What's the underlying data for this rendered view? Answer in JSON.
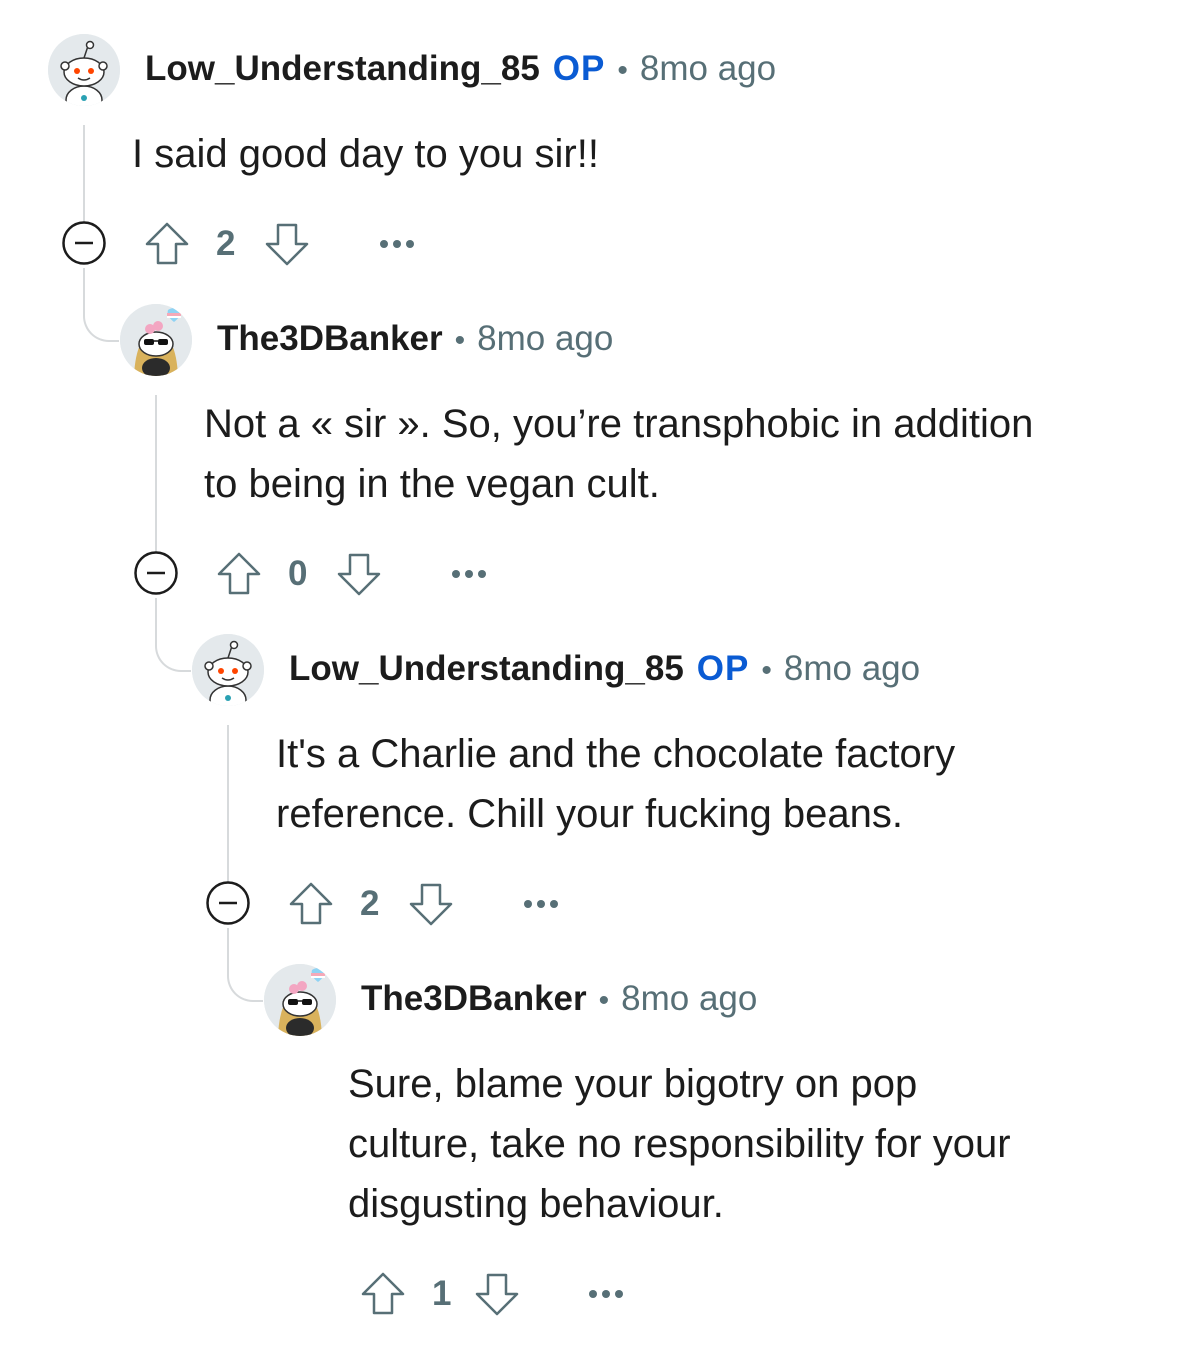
{
  "comments": [
    {
      "username": "Low_Understanding_85",
      "op_badge": "OP",
      "separator": "•",
      "time": "8mo ago",
      "lines": [
        "I said good day to you sir!!"
      ],
      "score": "2",
      "avatar_icon": "snoo-avatar-icon"
    },
    {
      "username": "The3DBanker",
      "op_badge": "",
      "separator": "•",
      "time": "8mo ago",
      "lines": [
        "Not a « sir ». So, you’re transphobic in addition",
        "to being in the vegan cult."
      ],
      "score": "0",
      "avatar_icon": "custom-snoo-avatar-icon"
    },
    {
      "username": "Low_Understanding_85",
      "op_badge": "OP",
      "separator": "•",
      "time": "8mo ago",
      "lines": [
        "It's a Charlie and the chocolate factory",
        "reference. Chill your fucking beans."
      ],
      "score": "2",
      "avatar_icon": "snoo-avatar-icon"
    },
    {
      "username": "The3DBanker",
      "op_badge": "",
      "separator": "•",
      "time": "8mo ago",
      "lines": [
        "Sure, blame your bigotry on pop",
        "culture, take no responsibility for your",
        "disgusting behaviour."
      ],
      "score": "1",
      "avatar_icon": "custom-snoo-avatar-icon"
    }
  ],
  "icons": {
    "upvote": "upvote-arrow-icon",
    "downvote": "downvote-arrow-icon",
    "collapse": "collapse-minus-icon",
    "more": "more-options-icon"
  },
  "colors": {
    "op_badge": "#0a5bd3",
    "meta_text": "#576f76",
    "thread_line": "#d7dadc",
    "text": "#1c1c1c"
  }
}
